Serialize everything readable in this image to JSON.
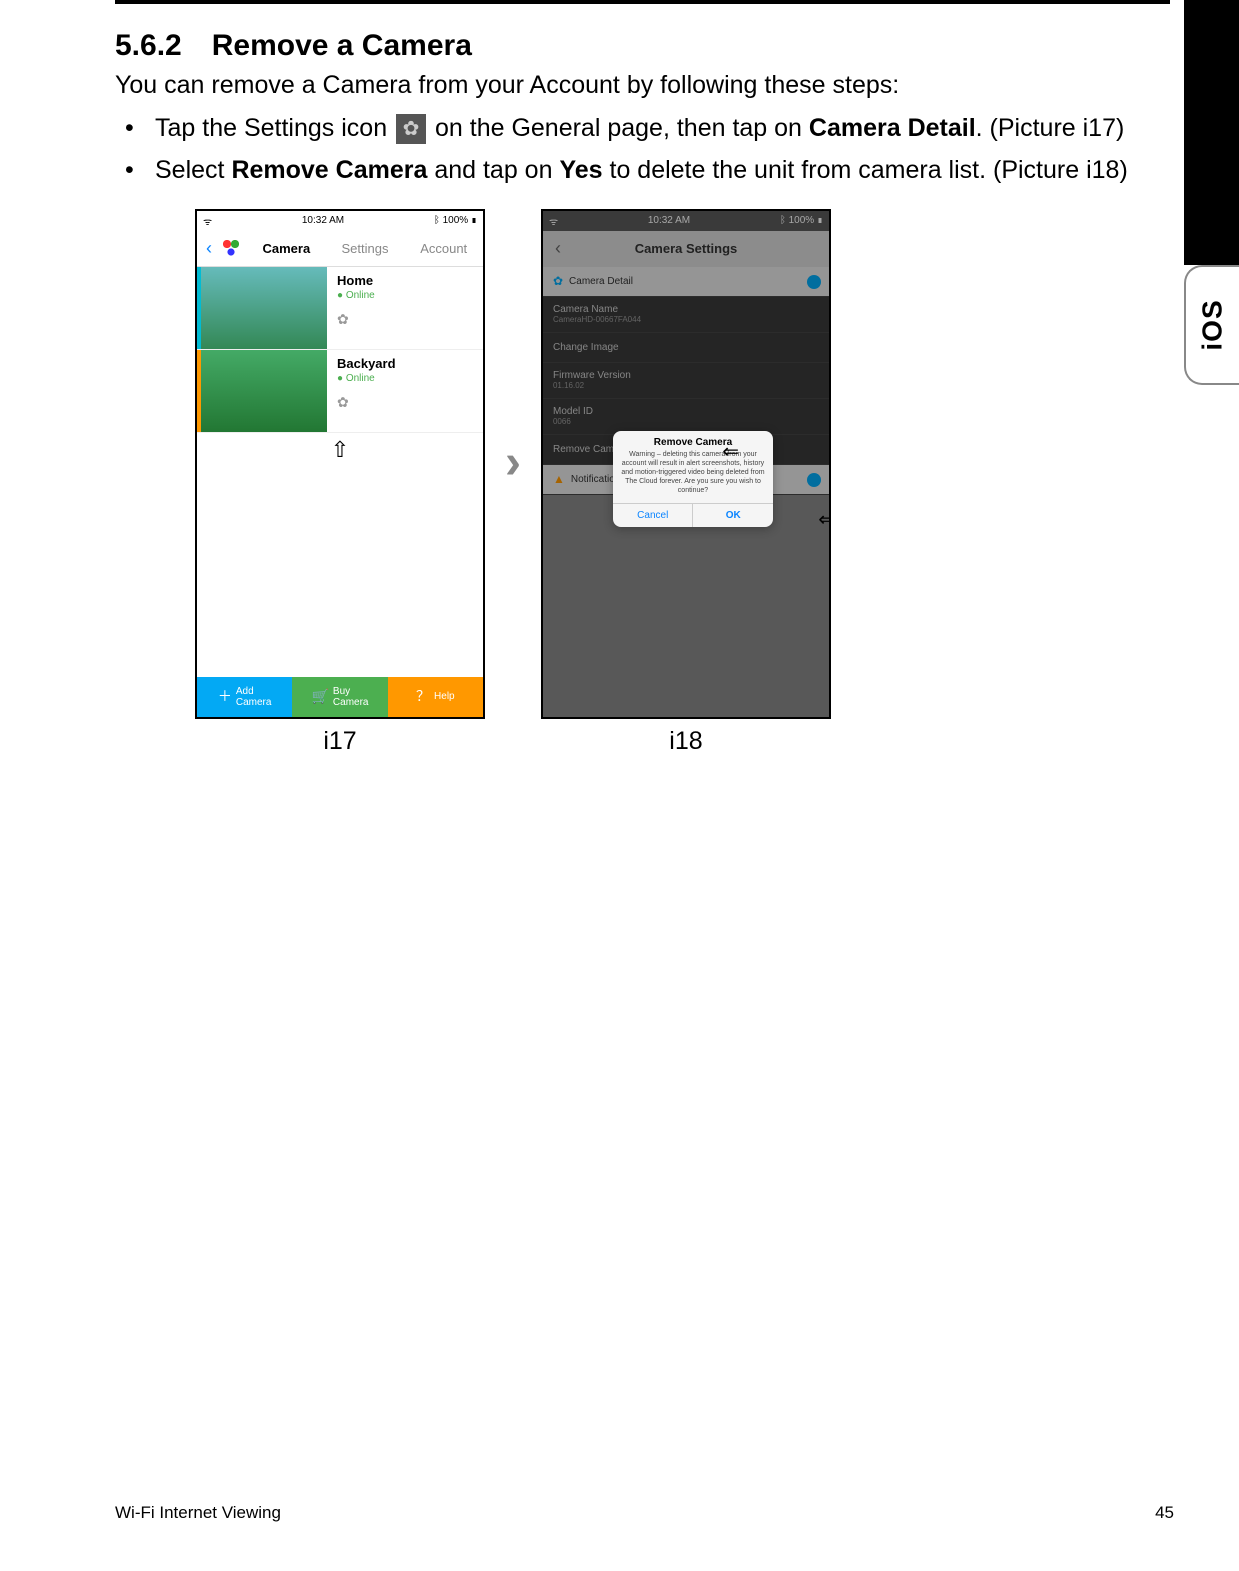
{
  "sidebar": {
    "ios_label": "iOS"
  },
  "section": {
    "number": "5.6.2",
    "title": "Remove a Camera",
    "intro": "You can remove a Camera from your Account by following these steps:",
    "step1_a": "Tap the Settings icon ",
    "step1_b": " on the General page, then tap on ",
    "step1_bold": "Camera Detail",
    "step1_c": ". (Picture i17)",
    "step2_a": "Select ",
    "step2_bold1": "Remove Camera",
    "step2_b": " and tap on ",
    "step2_bold2": "Yes",
    "step2_c": " to delete the unit from camera list. (Picture i18)"
  },
  "i17": {
    "caption": "i17",
    "status_time": "10:32 AM",
    "status_batt": "100%",
    "tabs": {
      "camera": "Camera",
      "settings": "Settings",
      "account": "Account"
    },
    "cam1": {
      "name": "Home",
      "status": "Online"
    },
    "cam2": {
      "name": "Backyard",
      "status": "Online"
    },
    "bottom": {
      "add": "Add\nCamera",
      "buy": "Buy\nCamera",
      "help": "Help"
    }
  },
  "i18": {
    "caption": "i18",
    "status_time": "10:32 AM",
    "status_batt": "100%",
    "header": "Camera Settings",
    "rows": {
      "detail": "Camera Detail",
      "name_label": "Camera Name",
      "name_value": "CameraHD-00667FA044",
      "change_image": "Change Image",
      "fw_label": "Firmware Version",
      "fw_value": "01.16.02",
      "model_label": "Model ID",
      "model_value": "0066",
      "remove": "Remove Camera",
      "notify": "Notificatio"
    },
    "dialog": {
      "title": "Remove Camera",
      "body": "Warning – deleting this camera from your account will result in alert screenshots, history and motion-triggered video being deleted from The Cloud forever. Are you sure you wish to continue?",
      "cancel": "Cancel",
      "ok": "OK"
    }
  },
  "footer": {
    "left": "Wi-Fi Internet Viewing",
    "right": "45"
  }
}
